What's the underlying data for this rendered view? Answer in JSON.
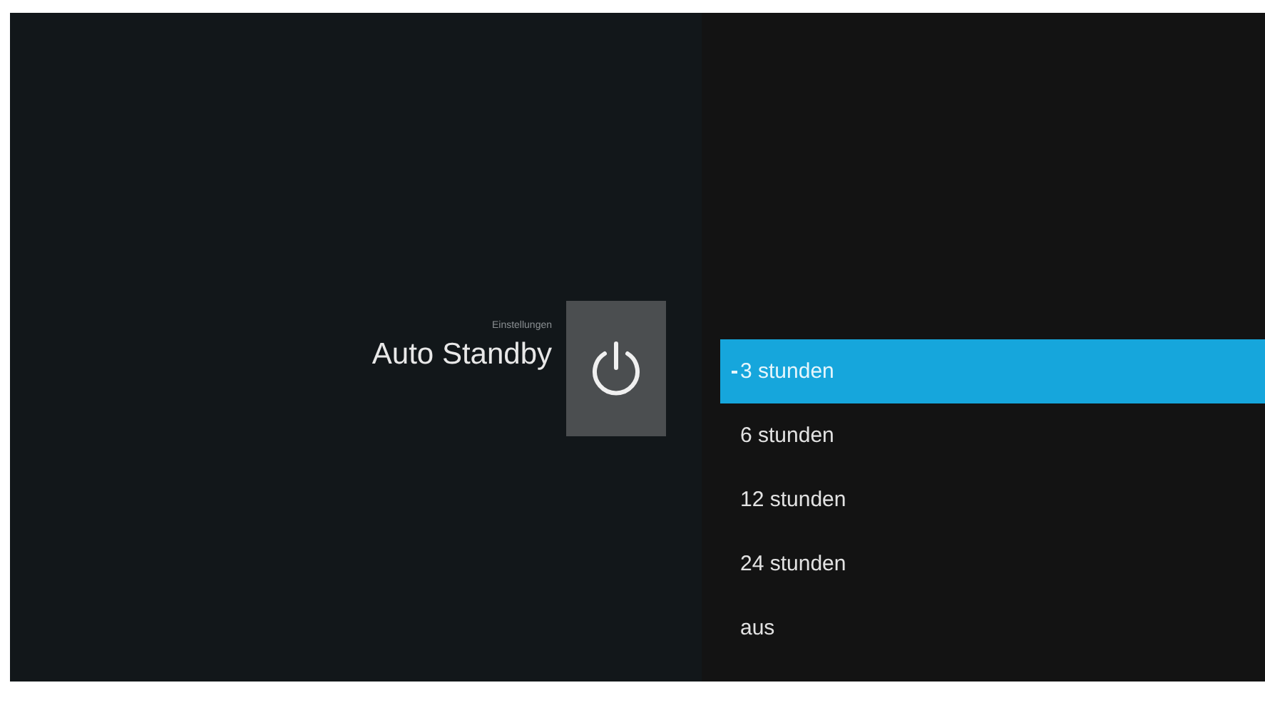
{
  "header": {
    "breadcrumb": "Einstellungen",
    "title": "Auto Standby"
  },
  "options": [
    {
      "label": "3 stunden",
      "selected": true
    },
    {
      "label": "6 stunden",
      "selected": false
    },
    {
      "label": "12 stunden",
      "selected": false
    },
    {
      "label": "24 stunden",
      "selected": false
    },
    {
      "label": "aus",
      "selected": false
    }
  ]
}
